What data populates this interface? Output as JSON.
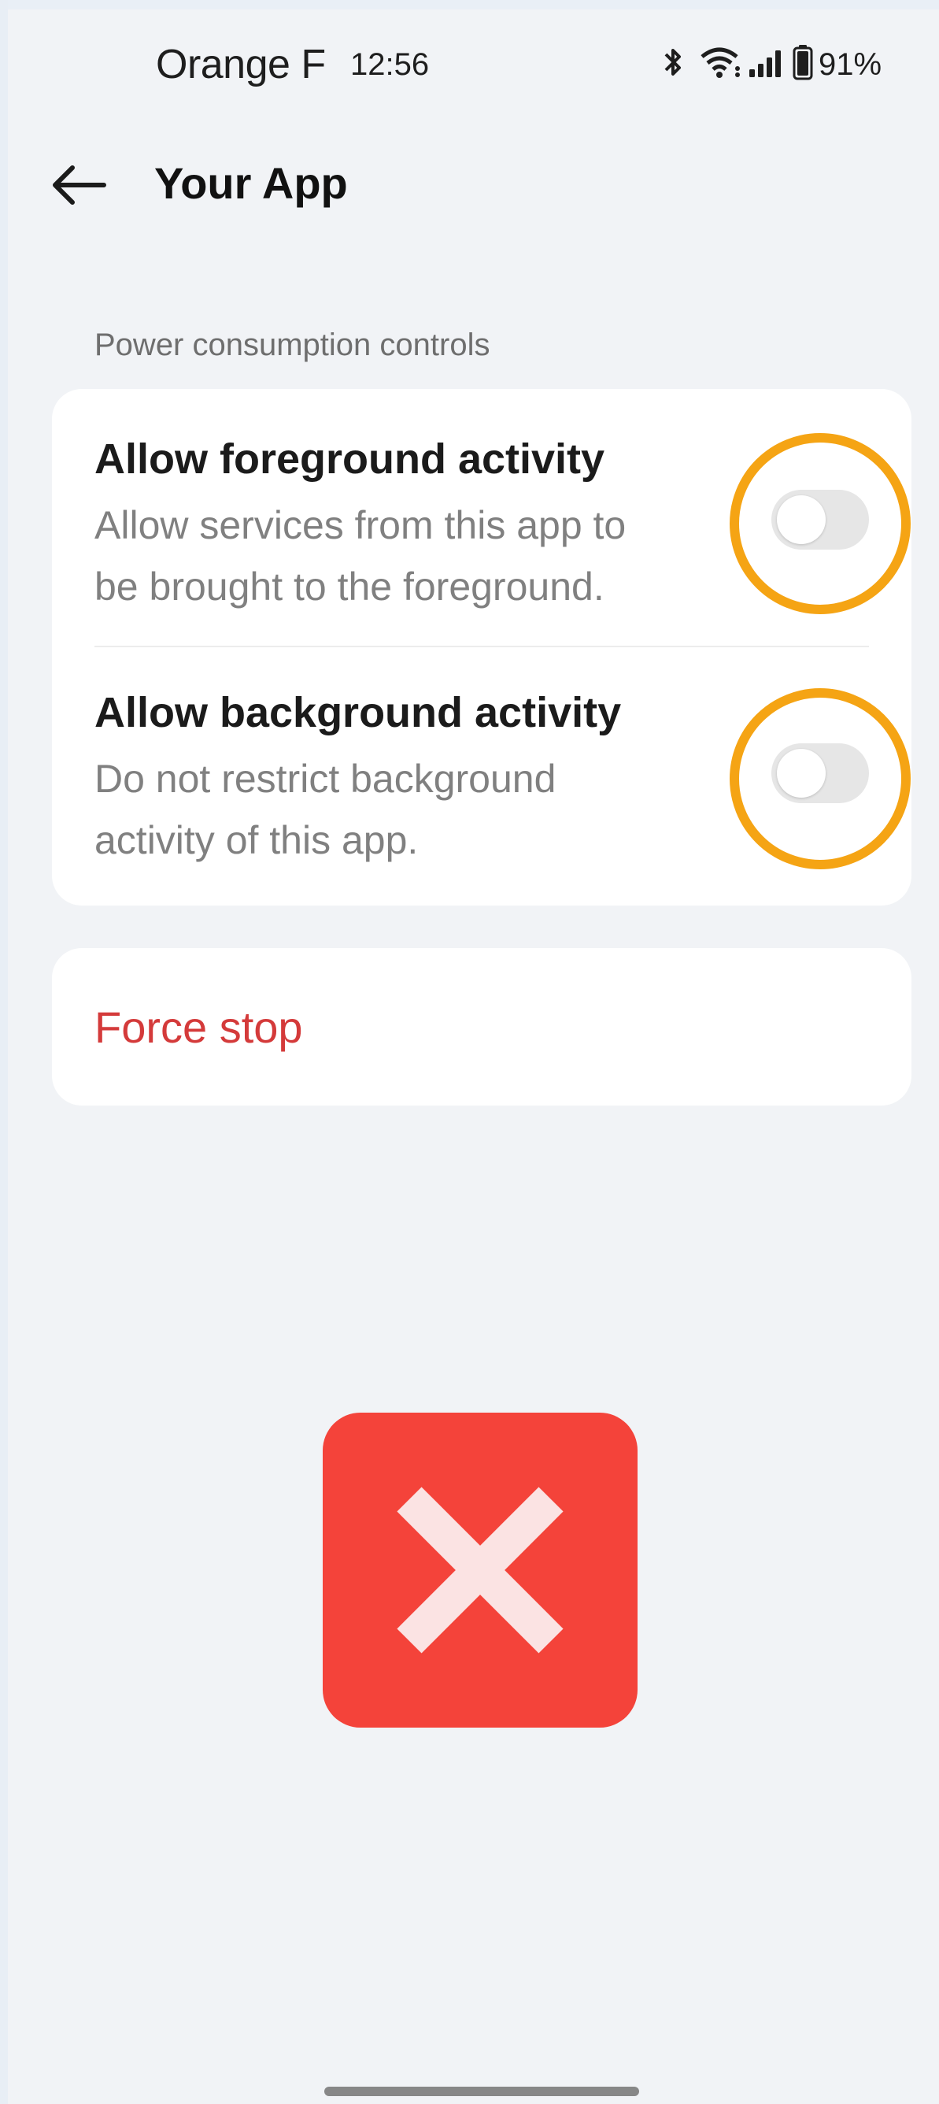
{
  "status_bar": {
    "carrier": "Orange F",
    "time": "12:56",
    "battery": "91%",
    "icons": [
      "bluetooth-icon",
      "wifi-icon",
      "signal-icon",
      "battery-icon"
    ]
  },
  "header": {
    "back_icon": "arrow-left-icon",
    "title": "Your App"
  },
  "section": {
    "label": "Power consumption controls"
  },
  "controls": [
    {
      "title": "Allow foreground activity",
      "description_line1": "Allow services from this app to",
      "description_line2": "be brought to the foreground.",
      "enabled": false,
      "highlighted": true
    },
    {
      "title": "Allow background activity",
      "description_line1": "Do not restrict background",
      "description_line2": "activity of this app.",
      "enabled": false,
      "highlighted": true
    }
  ],
  "force_stop": {
    "label": "Force stop",
    "color": "#d43a3a"
  },
  "overlay": {
    "icon": "close-x-icon",
    "color": "#f4433a"
  },
  "colors": {
    "highlight_ring": "#f5a414",
    "background": "#f1f3f6"
  }
}
